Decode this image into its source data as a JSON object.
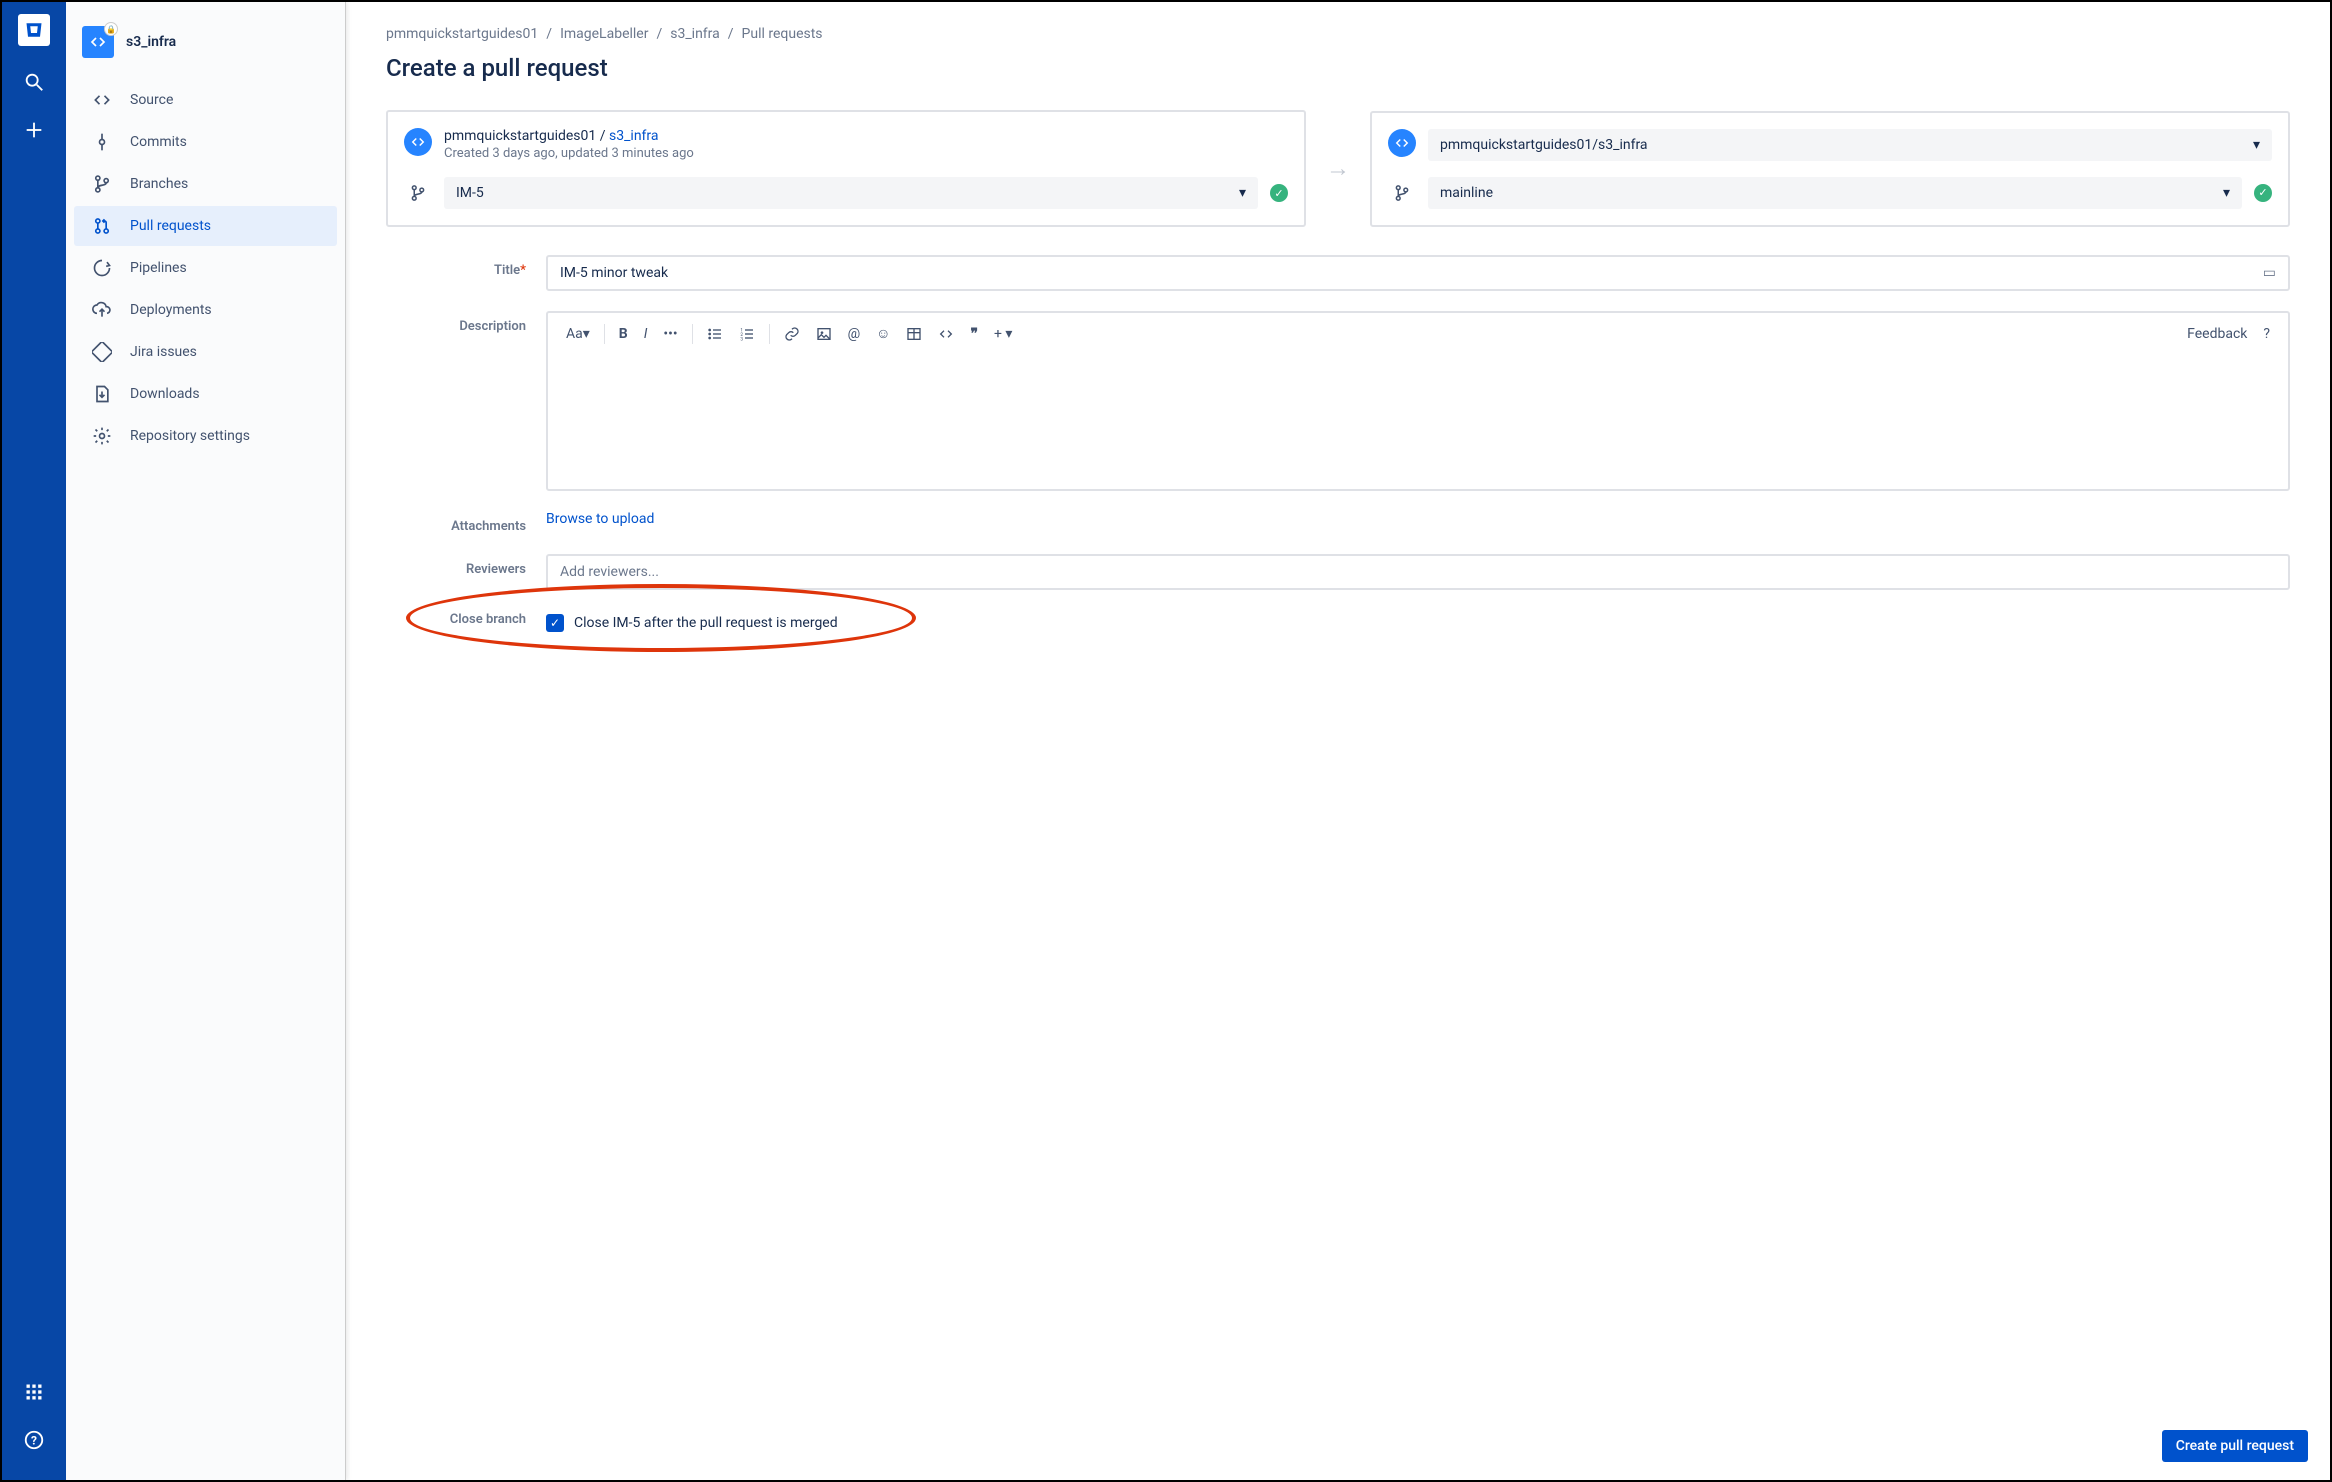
{
  "repo": {
    "name": "s3_infra"
  },
  "sidebar": {
    "items": [
      {
        "label": "Source"
      },
      {
        "label": "Commits"
      },
      {
        "label": "Branches"
      },
      {
        "label": "Pull requests"
      },
      {
        "label": "Pipelines"
      },
      {
        "label": "Deployments"
      },
      {
        "label": "Jira issues"
      },
      {
        "label": "Downloads"
      },
      {
        "label": "Repository settings"
      }
    ]
  },
  "breadcrumbs": [
    "pmmquickstartguides01",
    "ImageLabeller",
    "s3_infra",
    "Pull requests"
  ],
  "page_title": "Create a pull request",
  "source": {
    "owner": "pmmquickstartguides01",
    "repo": "s3_infra",
    "meta": "Created 3 days ago, updated 3 minutes ago",
    "branch": "IM-5"
  },
  "dest": {
    "repo_full": "pmmquickstartguides01/s3_infra",
    "branch": "mainline"
  },
  "form": {
    "title_label": "Title",
    "title_value": "IM-5 minor tweak",
    "description_label": "Description",
    "toolbar_text_styles": "Aa",
    "feedback": "Feedback",
    "attachments_label": "Attachments",
    "attachments_action": "Browse to upload",
    "reviewers_label": "Reviewers",
    "reviewers_placeholder": "Add reviewers...",
    "close_label": "Close branch",
    "close_text": "Close IM-5 after the pull request is merged"
  },
  "submit": "Create pull request",
  "slash": "/"
}
